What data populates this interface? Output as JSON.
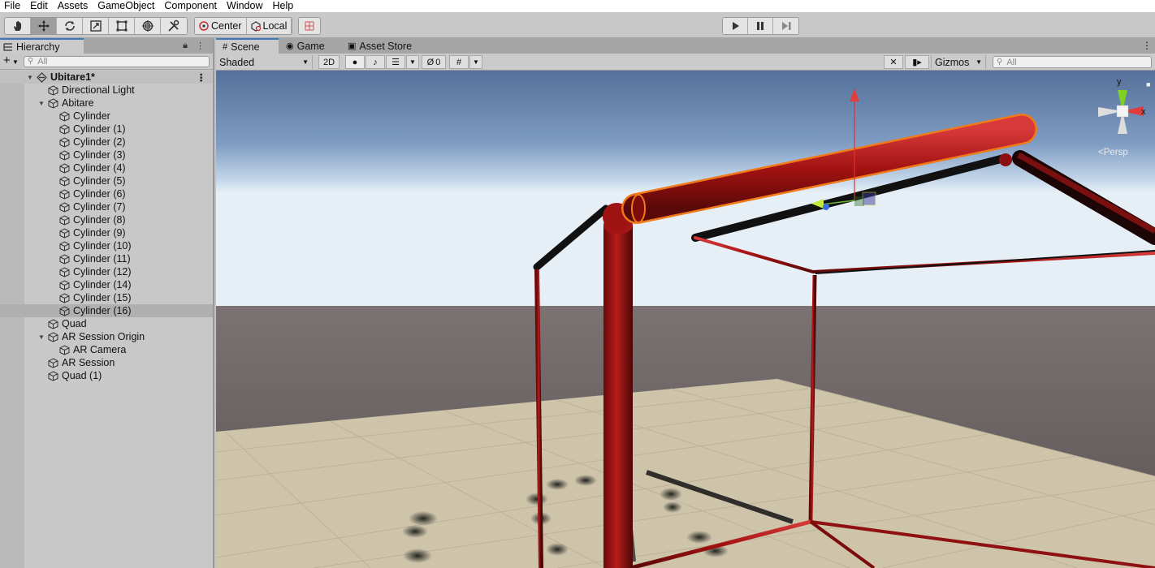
{
  "menu": [
    "File",
    "Edit",
    "Assets",
    "GameObject",
    "Component",
    "Window",
    "Help"
  ],
  "toolbar": {
    "tools": [
      "hand-tool",
      "move-tool",
      "rotate-tool",
      "scale-tool",
      "rect-tool",
      "transform-tool",
      "custom-tool"
    ],
    "pivot_mode": "Center",
    "pivot_rotation": "Local"
  },
  "hierarchy": {
    "tab_label": "Hierarchy",
    "search_placeholder": "All",
    "scene_name": "Ubitare1*",
    "items": [
      {
        "label": "Directional Light",
        "depth": 1
      },
      {
        "label": "Abitare",
        "depth": 1,
        "expanded": true
      },
      {
        "label": "Cylinder",
        "depth": 2
      },
      {
        "label": "Cylinder (1)",
        "depth": 2
      },
      {
        "label": "Cylinder (2)",
        "depth": 2
      },
      {
        "label": "Cylinder (3)",
        "depth": 2
      },
      {
        "label": "Cylinder (4)",
        "depth": 2
      },
      {
        "label": "Cylinder (5)",
        "depth": 2
      },
      {
        "label": "Cylinder (6)",
        "depth": 2
      },
      {
        "label": "Cylinder (7)",
        "depth": 2
      },
      {
        "label": "Cylinder (8)",
        "depth": 2
      },
      {
        "label": "Cylinder (9)",
        "depth": 2
      },
      {
        "label": "Cylinder (10)",
        "depth": 2
      },
      {
        "label": "Cylinder (11)",
        "depth": 2
      },
      {
        "label": "Cylinder (12)",
        "depth": 2
      },
      {
        "label": "Cylinder (14)",
        "depth": 2
      },
      {
        "label": "Cylinder (15)",
        "depth": 2
      },
      {
        "label": "Cylinder (16)",
        "depth": 2,
        "selected": true
      },
      {
        "label": "Quad",
        "depth": 1
      },
      {
        "label": "AR Session Origin",
        "depth": 1,
        "expanded": true
      },
      {
        "label": "AR Camera",
        "depth": 2
      },
      {
        "label": "AR Session",
        "depth": 1
      },
      {
        "label": "Quad (1)",
        "depth": 1
      }
    ]
  },
  "scene_panel": {
    "tabs": [
      "Scene",
      "Game",
      "Asset Store"
    ],
    "active_tab": "Scene",
    "draw_mode": "Shaded",
    "mode_2d": "2D",
    "hidden_count": "0",
    "gizmos_label": "Gizmos",
    "search_placeholder": "All",
    "axis_y": "y",
    "axis_x": "x",
    "projection": "Persp"
  },
  "colors": {
    "selection_outline": "#f07a1a",
    "cylinder": "#a41414",
    "sky_top": "#5a739c",
    "ground": "#cfc5ab",
    "tab_accent": "#3a79bb"
  }
}
